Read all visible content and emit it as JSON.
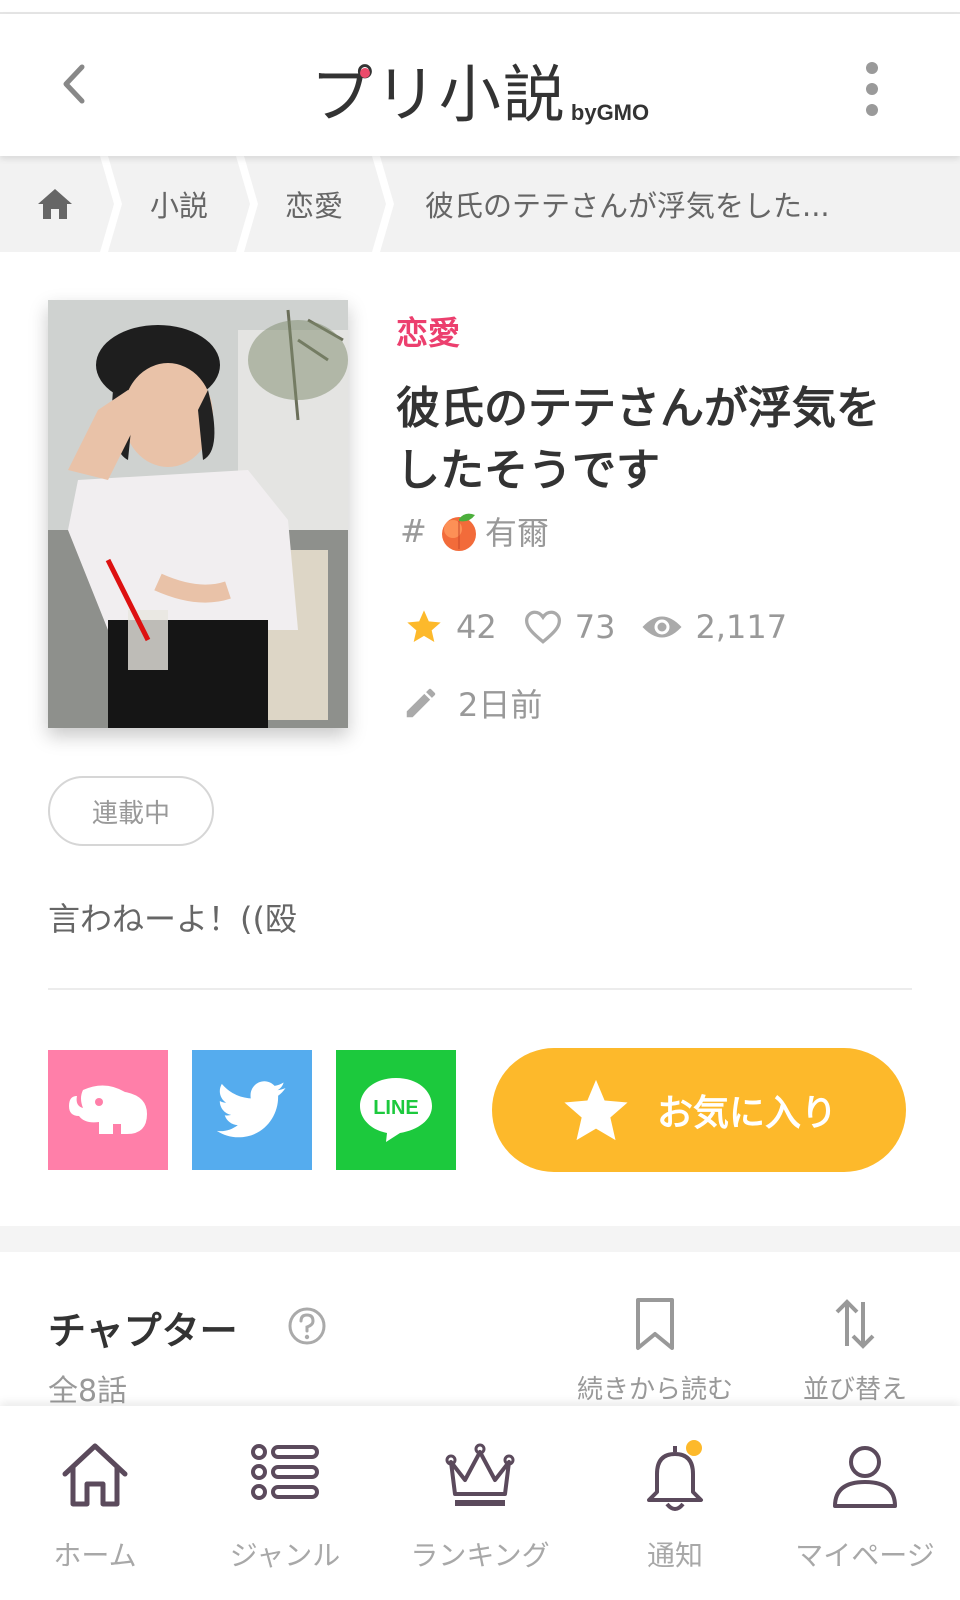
{
  "header": {
    "logo_main": "プリ小説",
    "logo_sub": "byGMO"
  },
  "breadcrumb": {
    "items": [
      "小説",
      "恋愛",
      "彼氏のテテさんが浮気をした..."
    ]
  },
  "book": {
    "genre": "恋愛",
    "title": "彼氏のテテさんが浮気をしたそうです",
    "author_prefix": "#",
    "author_name": "有爾",
    "stars": "42",
    "likes": "73",
    "views": "2,117",
    "updated": "2日前",
    "status": "連載中",
    "description": "言わねーよ！((殴"
  },
  "actions": {
    "favorite_label": "お気に入り",
    "line_label": "LINE"
  },
  "chapters": {
    "title": "チャプター",
    "count": "全8話",
    "resume_label": "続きから読む",
    "sort_label": "並び替え"
  },
  "tabbar": {
    "items": [
      {
        "label": "ホーム"
      },
      {
        "label": "ジャンル"
      },
      {
        "label": "ランキング"
      },
      {
        "label": "通知"
      },
      {
        "label": "マイページ"
      }
    ]
  },
  "colors": {
    "accent_pink": "#ec3f6e",
    "favorite_yellow": "#fdb92b",
    "twitter_blue": "#55acee",
    "line_green": "#1cc93d",
    "papu_pink": "#ff7fa9"
  }
}
